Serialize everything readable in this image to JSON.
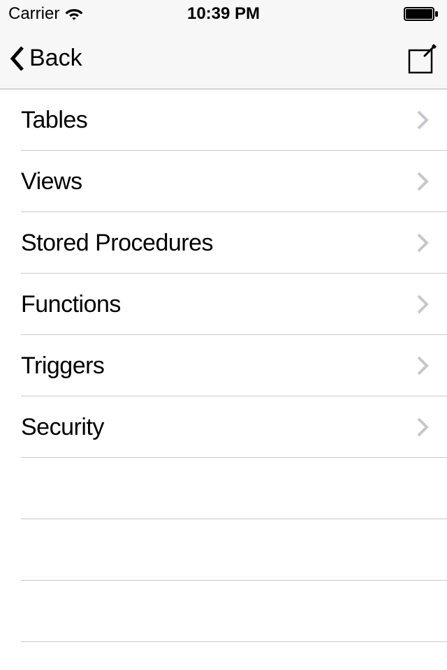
{
  "status": {
    "carrier": "Carrier",
    "time": "10:39 PM"
  },
  "nav": {
    "back_label": "Back"
  },
  "list": {
    "items": [
      {
        "label": "Tables"
      },
      {
        "label": "Views"
      },
      {
        "label": "Stored Procedures"
      },
      {
        "label": "Functions"
      },
      {
        "label": "Triggers"
      },
      {
        "label": "Security"
      }
    ]
  }
}
